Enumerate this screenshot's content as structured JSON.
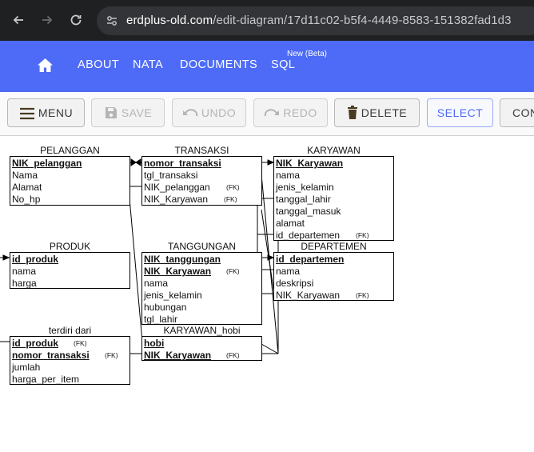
{
  "browser": {
    "url_host": "erdplus-old.com",
    "url_path": "/edit-diagram/17d11c02-b5f4-4449-8583-151382fad1d3"
  },
  "nav": {
    "about": "ABOUT",
    "nata": "NATA",
    "documents": "DOCUMENTS",
    "sql": "SQL",
    "sql_badge": "New (Beta)"
  },
  "toolbar": {
    "menu": "MENU",
    "save": "SAVE",
    "undo": "UNDO",
    "redo": "REDO",
    "delete": "DELETE",
    "select": "SELECT",
    "con": "CON"
  },
  "fk_label": "(FK)",
  "entities": {
    "pelanggan": {
      "title": "PELANGGAN",
      "attrs": [
        "NIK_pelanggan",
        "Nama",
        "Alamat",
        "No_hp"
      ]
    },
    "transaksi": {
      "title": "TRANSAKSI",
      "attrs": [
        "nomor_transaksi",
        "tgl_transaksi",
        "NIK_pelanggan",
        "NIK_Karyawan"
      ]
    },
    "karyawan": {
      "title": "KARYAWAN",
      "attrs": [
        "NIK_Karyawan",
        "nama",
        "jenis_kelamin",
        "tanggal_lahir",
        "tanggal_masuk",
        "alamat",
        "id_departemen"
      ]
    },
    "produk": {
      "title": "PRODUK",
      "attrs": [
        "id_produk",
        "nama",
        "harga"
      ]
    },
    "tanggungan": {
      "title": "TANGGUNGAN",
      "attrs": [
        "NIK_tanggungan",
        "NIK_Karyawan",
        "nama",
        "jenis_kelamin",
        "hubungan",
        "tgl_lahir"
      ]
    },
    "departemen": {
      "title": "DEPARTEMEN",
      "attrs": [
        "id_departemen",
        "nama",
        "deskripsi",
        "NIK_Karyawan"
      ]
    },
    "terdiri_dari": {
      "title": "terdiri dari",
      "attrs": [
        "id_produk",
        "nomor_transaksi",
        "jumlah",
        "harga_per_item"
      ]
    },
    "karyawan_hobi": {
      "title": "KARYAWAN_hobi",
      "attrs": [
        "hobi",
        "NIK_Karyawan"
      ]
    }
  }
}
